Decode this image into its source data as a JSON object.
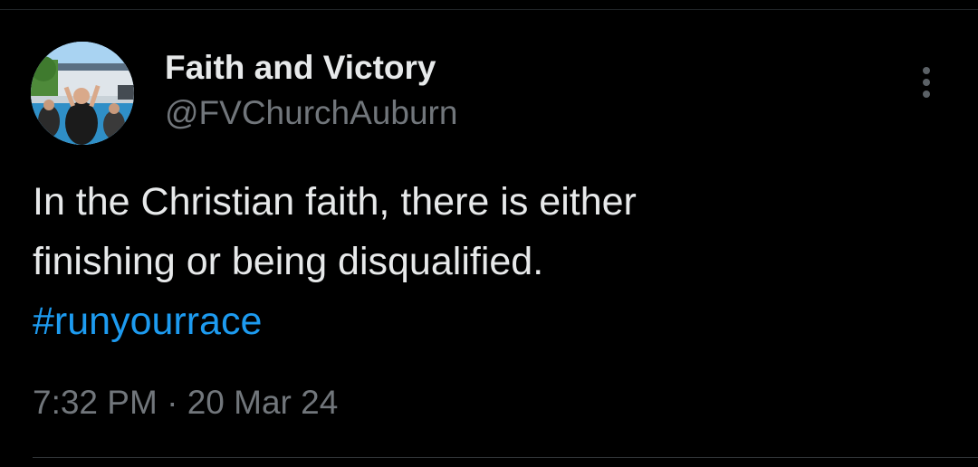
{
  "author": {
    "display_name": "Faith and Victory",
    "handle": "@FVChurchAuburn"
  },
  "tweet": {
    "text_line_1": "In the Christian faith, there is either",
    "text_line_2": "finishing or being disqualified.",
    "hashtag": "#runyourrace"
  },
  "meta": {
    "time": "7:32 PM",
    "separator": " · ",
    "date": "20 Mar 24"
  },
  "icons": {
    "more": "more-vertical-icon"
  },
  "colors": {
    "background": "#000000",
    "primary_text": "#e7e9ea",
    "secondary_text": "#71767b",
    "link": "#1d9bf0"
  }
}
